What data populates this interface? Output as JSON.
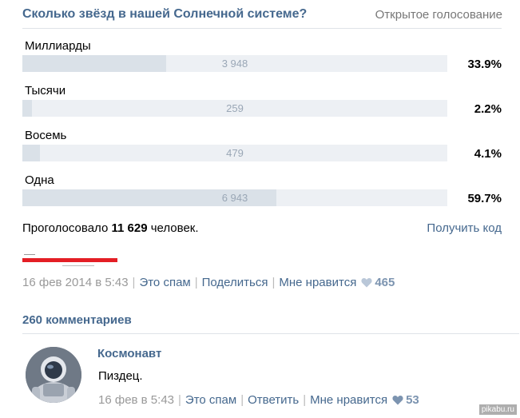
{
  "poll": {
    "title": "Сколько звёзд в нашей Солнечной системе?",
    "type": "Открытое голосование",
    "options": [
      {
        "label": "Миллиарды",
        "count": "3 948",
        "percent": "33.9%",
        "fraction": 0.339
      },
      {
        "label": "Тысячи",
        "count": "259",
        "percent": "2.2%",
        "fraction": 0.022
      },
      {
        "label": "Восемь",
        "count": "479",
        "percent": "4.1%",
        "fraction": 0.041
      },
      {
        "label": "Одна",
        "count": "6 943",
        "percent": "59.7%",
        "fraction": 0.597
      }
    ],
    "voted_prefix": "Проголосовало",
    "voted_count": "11 629",
    "voted_suffix": "человек.",
    "get_code": "Получить код"
  },
  "post_meta": {
    "date": "16 фев 2014 в 5:43",
    "spam": "Это спам",
    "share": "Поделиться",
    "like": "Мне нравится",
    "like_count": "465"
  },
  "comments": {
    "count_label": "260 комментариев",
    "items": [
      {
        "author": "Космонавт",
        "text": "Пиздец.",
        "date": "16 фев в 5:43",
        "spam": "Это спам",
        "reply": "Ответить",
        "like": "Мне нравится",
        "like_count": "53"
      }
    ]
  },
  "watermark": "pikabu.ru",
  "colors": {
    "link": "#45688e",
    "bar_track": "#edf0f4",
    "bar_fill": "#dae1e8",
    "redaction": "#e41e25"
  }
}
